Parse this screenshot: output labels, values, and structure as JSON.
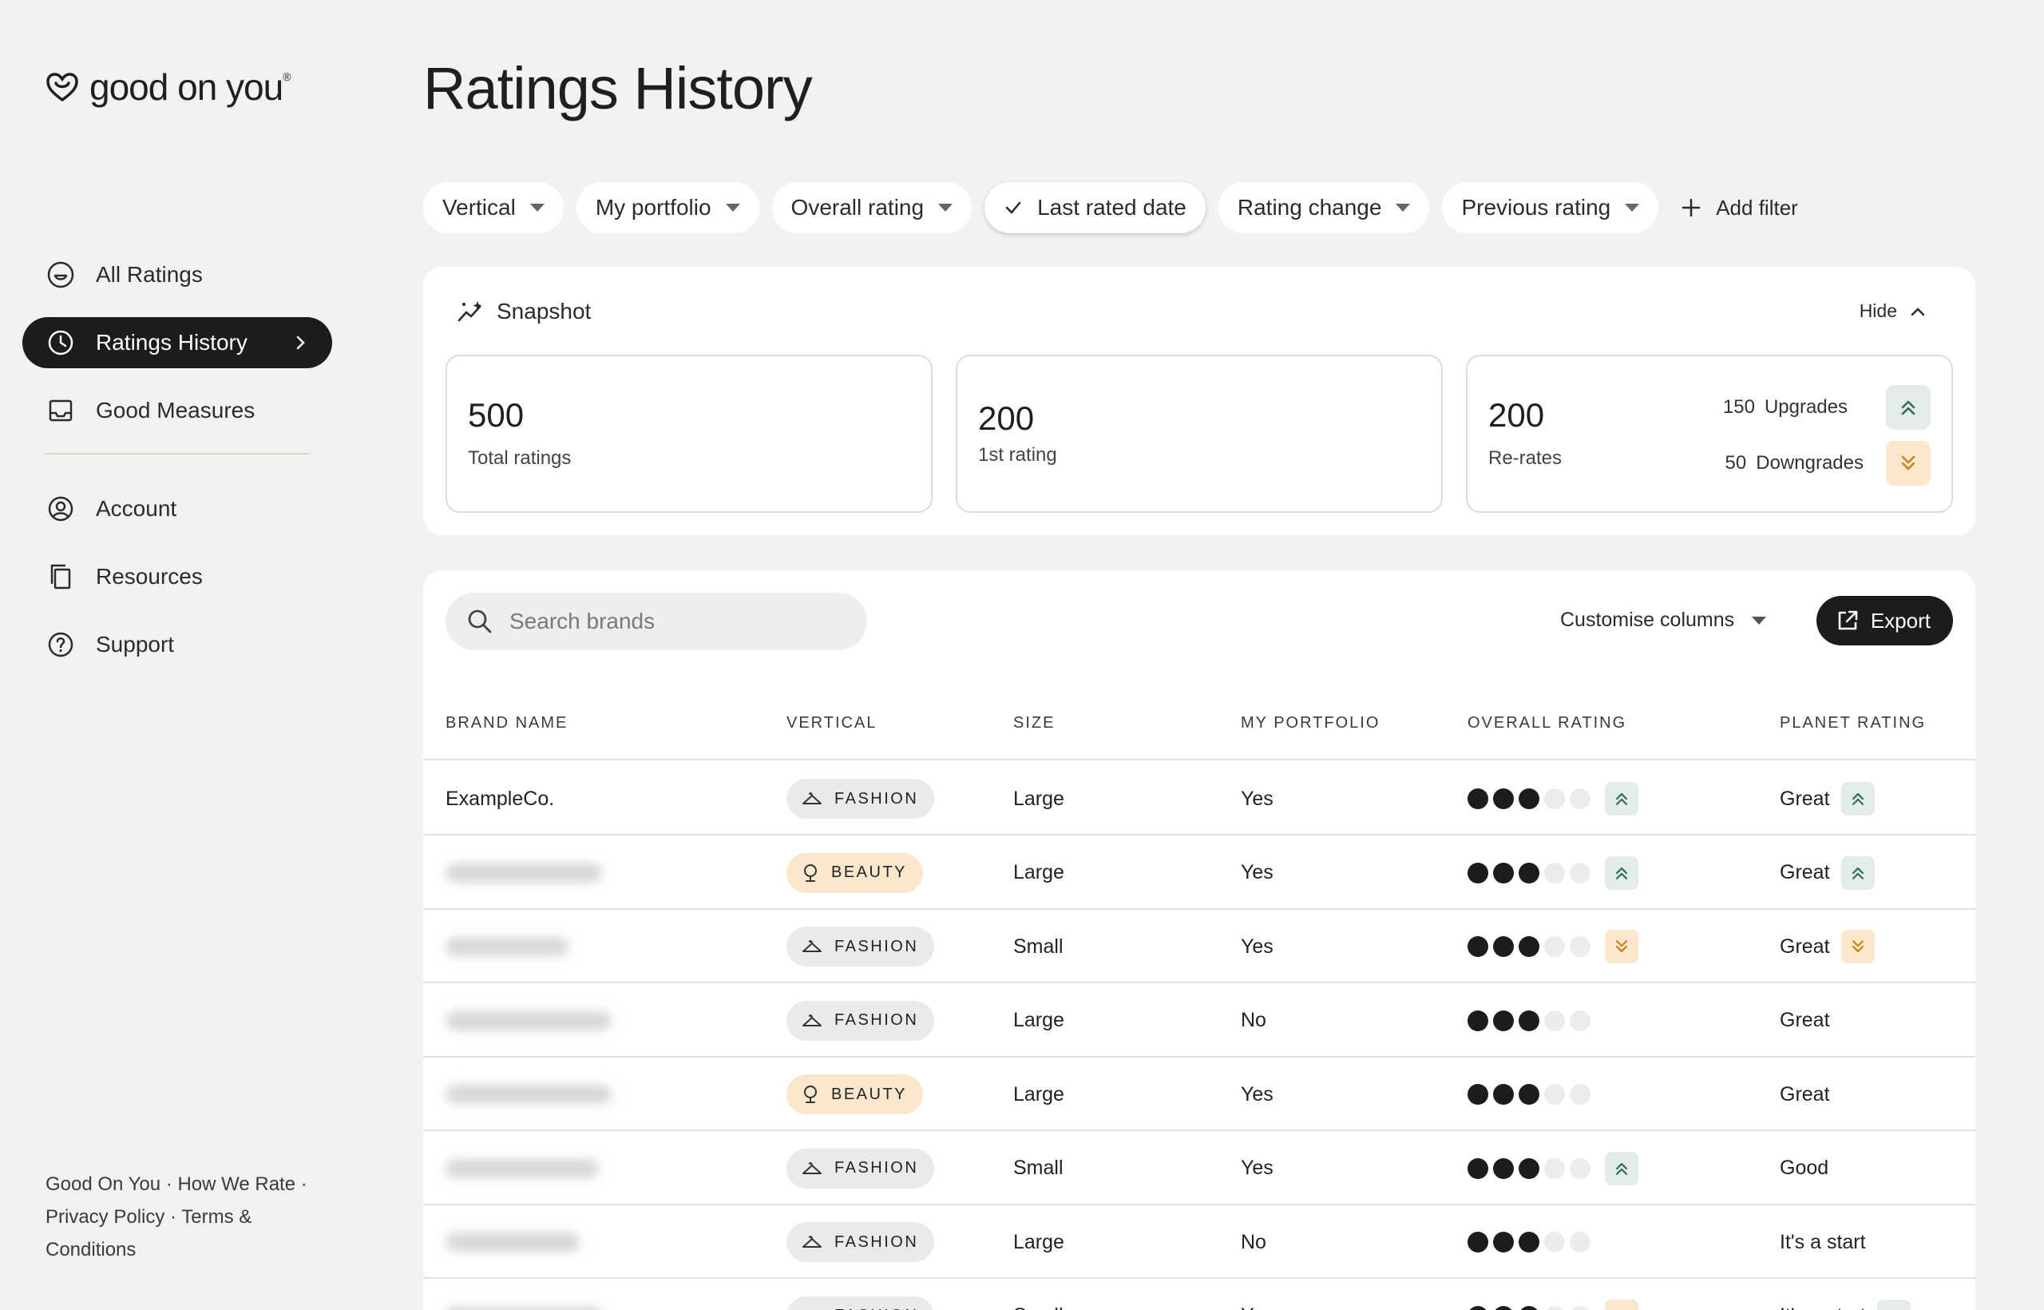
{
  "brand": {
    "name": "good on you",
    "mark": "®"
  },
  "sidebar": {
    "items": [
      {
        "label": "All Ratings",
        "icon": "smiley-icon",
        "active": false
      },
      {
        "label": "Ratings History",
        "icon": "clock-icon",
        "active": true
      },
      {
        "label": "Good Measures",
        "icon": "inbox-icon",
        "active": false
      },
      {
        "label": "Account",
        "icon": "user-circle-icon",
        "active": false
      },
      {
        "label": "Resources",
        "icon": "copy-icon",
        "active": false
      },
      {
        "label": "Support",
        "icon": "help-icon",
        "active": false
      }
    ],
    "footer": "Good On You · How We Rate · Privacy Policy · Terms & Conditions"
  },
  "page": {
    "title": "Ratings History"
  },
  "filters": {
    "chips": [
      {
        "label": "Vertical",
        "active": false
      },
      {
        "label": "My portfolio",
        "active": false
      },
      {
        "label": "Overall rating",
        "active": false
      },
      {
        "label": "Last rated date",
        "active": true
      },
      {
        "label": "Rating change",
        "active": false
      },
      {
        "label": "Previous rating",
        "active": false
      }
    ],
    "add_label": "Add filter"
  },
  "snapshot": {
    "title": "Snapshot",
    "hide_label": "Hide",
    "total": {
      "value": "500",
      "label": "Total ratings"
    },
    "first": {
      "value": "200",
      "label": "1st rating"
    },
    "rerates": {
      "value": "200",
      "label": "Re-rates",
      "upgrades_count": "150",
      "upgrades_label": "Upgrades",
      "downgrades_count": "50",
      "downgrades_label": "Downgrades"
    }
  },
  "table": {
    "search_placeholder": "Search brands",
    "customise_label": "Customise columns",
    "export_label": "Export",
    "columns": [
      "BRAND NAME",
      "VERTICAL",
      "SIZE",
      "MY PORTFOLIO",
      "OVERALL RATING",
      "PLANET RATING"
    ],
    "rating_max": 5,
    "rows": [
      {
        "brand": "ExampleCo.",
        "blurred": false,
        "vertical": "FASHION",
        "size": "Large",
        "portfolio": "Yes",
        "overall": 3,
        "overall_change": "up",
        "planet": "Great",
        "planet_change": "up"
      },
      {
        "brand": "",
        "blurred": true,
        "vertical": "BEAUTY",
        "size": "Large",
        "portfolio": "Yes",
        "overall": 3,
        "overall_change": "up",
        "planet": "Great",
        "planet_change": "up"
      },
      {
        "brand": "",
        "blurred": true,
        "vertical": "FASHION",
        "size": "Small",
        "portfolio": "Yes",
        "overall": 3,
        "overall_change": "down",
        "planet": "Great",
        "planet_change": "down"
      },
      {
        "brand": "",
        "blurred": true,
        "vertical": "FASHION",
        "size": "Large",
        "portfolio": "No",
        "overall": 3,
        "overall_change": "",
        "planet": "Great",
        "planet_change": ""
      },
      {
        "brand": "",
        "blurred": true,
        "vertical": "BEAUTY",
        "size": "Large",
        "portfolio": "Yes",
        "overall": 3,
        "overall_change": "",
        "planet": "Great",
        "planet_change": ""
      },
      {
        "brand": "",
        "blurred": true,
        "vertical": "FASHION",
        "size": "Small",
        "portfolio": "Yes",
        "overall": 3,
        "overall_change": "up",
        "planet": "Good",
        "planet_change": ""
      },
      {
        "brand": "",
        "blurred": true,
        "vertical": "FASHION",
        "size": "Large",
        "portfolio": "No",
        "overall": 3,
        "overall_change": "",
        "planet": "It's a start",
        "planet_change": ""
      },
      {
        "brand": "",
        "blurred": true,
        "vertical": "FASHION",
        "size": "Small",
        "portfolio": "Yes",
        "overall": 3,
        "overall_change": "down",
        "planet": "It's a start",
        "planet_change": "up"
      }
    ]
  },
  "colors": {
    "accent_dark": "#1c1c1c",
    "upgrade_bg": "#e4ecea",
    "upgrade_fg": "#2e6b62",
    "downgrade_bg": "#fbe7cc",
    "downgrade_fg": "#c9821c",
    "page_bg": "#f3f2f0"
  }
}
